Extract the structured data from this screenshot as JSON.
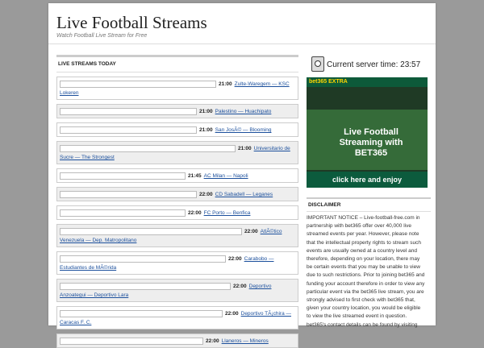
{
  "site": {
    "title": "Live Football Streams",
    "tagline": "Watch Football Live Stream for Free"
  },
  "streams": {
    "heading": "LIVE STREAMS TODAY",
    "rows": [
      {
        "time": "21:00",
        "teams": "Zulte-Waregem — KSC Lokeren"
      },
      {
        "time": "21:00",
        "teams": "Palestino — Huachipato"
      },
      {
        "time": "21:00",
        "teams": "San JosÃ© — Blooming"
      },
      {
        "time": "21:00",
        "teams": "Universitario de Sucre — The Strongest"
      },
      {
        "time": "21:45",
        "teams": "AC Milan — Napoli"
      },
      {
        "time": "22:00",
        "teams": "CD Sabadell — Leganes"
      },
      {
        "time": "22:00",
        "teams": "FC Porto — Benfica"
      },
      {
        "time": "22:00",
        "teams": "AtlÃ©tico Venezuela — Dep. Matropolitano"
      },
      {
        "time": "22:00",
        "teams": "Carabobo — Estudiantes de MÃ©rida"
      },
      {
        "time": "22:00",
        "teams": "Deportivo Anzoategui — Deportivo Lara"
      },
      {
        "time": "22:00",
        "teams": "Deportivo TÃ¡chira — Caracas F. C."
      },
      {
        "time": "22:00",
        "teams": "Llaneros — Mineros"
      }
    ]
  },
  "sidebar": {
    "server_label": "Current server time: 23:57",
    "ad": {
      "brand": "bet365 EXTRA",
      "headline": "Live Football Streaming with BET365",
      "button": "click here and enjoy"
    },
    "disclaimer_title": "DISCLAIMER",
    "disclaimer_text": "IMPORTANT NOTICE – Live-football-free.com in partnership with bet365 offer over 40,000 live streamed events per year. However, please note that the intellectual property rights to stream such events are usually owned at a country level and therefore, depending on your location, there may be certain events that you may be unable to view due to such restrictions. Prior to joining bet365 and funding your account therefore in order to view any particular event via the bet365 live stream, you are strongly advised to first check with bet365 that, given your country location, you would be eligible to view the live streamed event in question. bet365's contact details can be found by visiting"
  }
}
